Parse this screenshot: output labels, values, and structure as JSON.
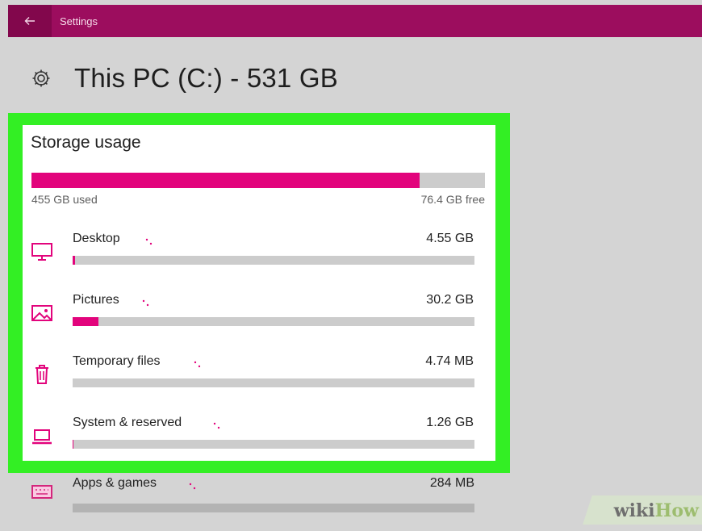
{
  "window": {
    "title": "Settings"
  },
  "header": {
    "title": "This PC (C:) - 531 GB"
  },
  "storage": {
    "title": "Storage usage",
    "used_label": "455 GB used",
    "free_label": "76.4 GB free",
    "used_fraction": 0.856,
    "categories": [
      {
        "name": "Desktop",
        "size": "4.55 GB",
        "fraction": 0.006,
        "icon": "monitor-icon"
      },
      {
        "name": "Pictures",
        "size": "30.2 GB",
        "fraction": 0.065,
        "icon": "picture-icon"
      },
      {
        "name": "Temporary files",
        "size": "4.74 MB",
        "fraction": 0.0,
        "icon": "trash-icon"
      },
      {
        "name": "System & reserved",
        "size": "1.26 GB",
        "fraction": 0.002,
        "icon": "laptop-icon"
      }
    ],
    "more": {
      "name": "Apps & games",
      "size": "284 MB",
      "icon": "keyboard-icon"
    }
  },
  "watermark": {
    "part1": "wiki",
    "part2": "How"
  },
  "colors": {
    "accent": "#e2047c",
    "titlebar": "#9c0d5e",
    "highlight": "#33ef24",
    "track": "#cccccc"
  }
}
